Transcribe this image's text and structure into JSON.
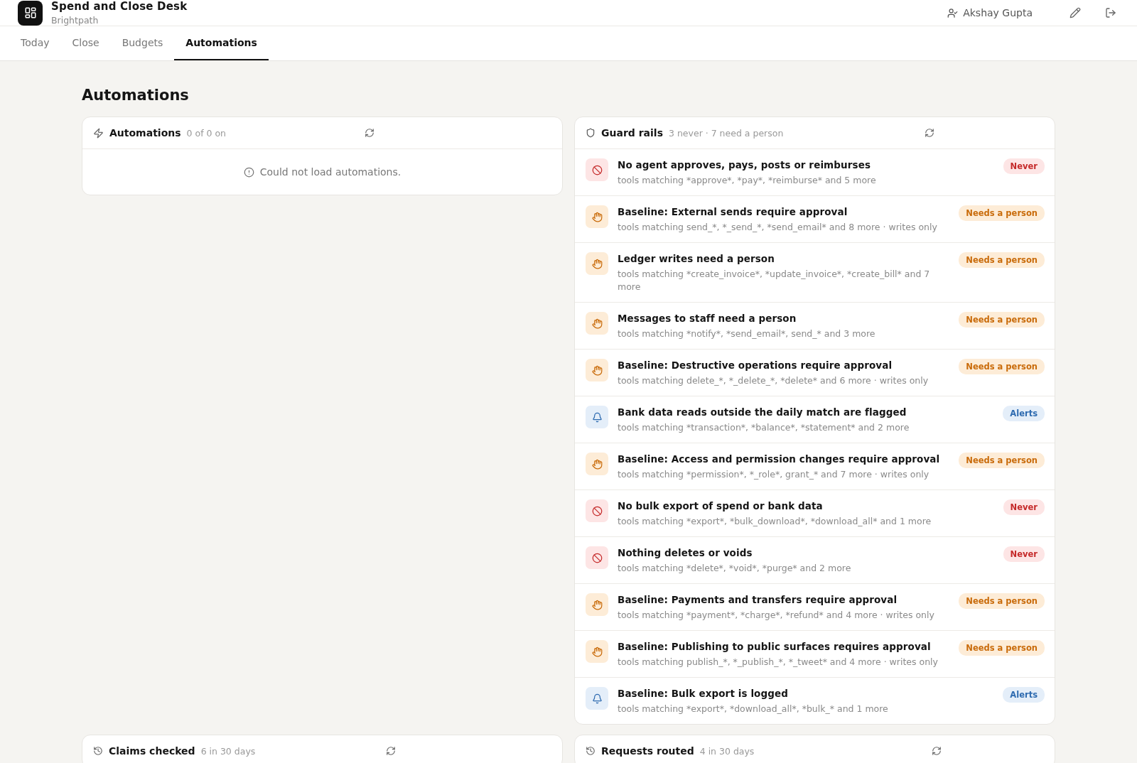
{
  "header": {
    "app_title": "Spend and Close Desk",
    "org": "Brightpath",
    "user": "Akshay Gupta"
  },
  "tabs": [
    {
      "label": "Today",
      "selected": false
    },
    {
      "label": "Close",
      "selected": false
    },
    {
      "label": "Budgets",
      "selected": false
    },
    {
      "label": "Automations",
      "selected": true
    }
  ],
  "page_title": "Automations",
  "automations_card": {
    "title": "Automations",
    "summary": "0 of 0 on",
    "error": "Could not load automations."
  },
  "guard_rails": {
    "title": "Guard rails",
    "summary": "3 never · 7 need a person",
    "rules": [
      {
        "kind": "never",
        "title": "No agent approves, pays, posts or reimburses",
        "detail": "tools matching *approve*, *pay*, *reimburse* and 5 more",
        "badge": "Never"
      },
      {
        "kind": "person",
        "title": "Baseline: External sends require approval",
        "detail": "tools matching send_*, *_send_*, *send_email* and 8 more · writes only",
        "badge": "Needs a person"
      },
      {
        "kind": "person",
        "title": "Ledger writes need a person",
        "detail": "tools matching *create_invoice*, *update_invoice*, *create_bill* and 7 more",
        "badge": "Needs a person"
      },
      {
        "kind": "person",
        "title": "Messages to staff need a person",
        "detail": "tools matching *notify*, *send_email*, send_* and 3 more",
        "badge": "Needs a person"
      },
      {
        "kind": "person",
        "title": "Baseline: Destructive operations require approval",
        "detail": "tools matching delete_*, *_delete_*, *delete* and 6 more · writes only",
        "badge": "Needs a person"
      },
      {
        "kind": "alert",
        "title": "Bank data reads outside the daily match are flagged",
        "detail": "tools matching *transaction*, *balance*, *statement* and 2 more",
        "badge": "Alerts"
      },
      {
        "kind": "person",
        "title": "Baseline: Access and permission changes require approval",
        "detail": "tools matching *permission*, *_role*, grant_* and 7 more · writes only",
        "badge": "Needs a person"
      },
      {
        "kind": "never",
        "title": "No bulk export of spend or bank data",
        "detail": "tools matching *export*, *bulk_download*, *download_all* and 1 more",
        "badge": "Never"
      },
      {
        "kind": "never",
        "title": "Nothing deletes or voids",
        "detail": "tools matching *delete*, *void*, *purge* and 2 more",
        "badge": "Never"
      },
      {
        "kind": "person",
        "title": "Baseline: Payments and transfers require approval",
        "detail": "tools matching *payment*, *charge*, *refund* and 4 more · writes only",
        "badge": "Needs a person"
      },
      {
        "kind": "person",
        "title": "Baseline: Publishing to public surfaces requires approval",
        "detail": "tools matching publish_*, *_publish_*, *_tweet* and 4 more · writes only",
        "badge": "Needs a person"
      },
      {
        "kind": "alert",
        "title": "Baseline: Bulk export is logged",
        "detail": "tools matching *export*, *download_all*, *bulk_* and 1 more",
        "badge": "Alerts"
      }
    ]
  },
  "bottom_cards": [
    {
      "title": "Claims checked",
      "summary": "6 in 30 days"
    },
    {
      "title": "Requests routed",
      "summary": "4 in 30 days"
    }
  ]
}
